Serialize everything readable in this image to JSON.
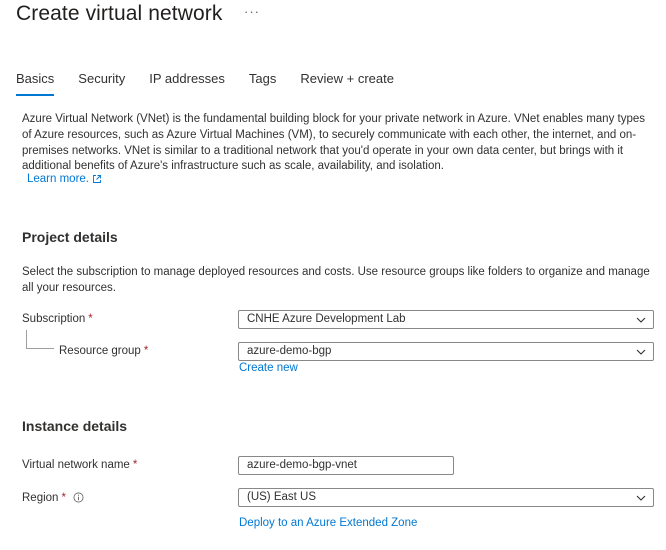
{
  "header": {
    "title": "Create virtual network",
    "more_label": "···"
  },
  "tabs": [
    {
      "label": "Basics",
      "active": true
    },
    {
      "label": "Security",
      "active": false
    },
    {
      "label": "IP addresses",
      "active": false
    },
    {
      "label": "Tags",
      "active": false
    },
    {
      "label": "Review + create",
      "active": false
    }
  ],
  "intro": {
    "text": "Azure Virtual Network (VNet) is the fundamental building block for your private network in Azure. VNet enables many types of Azure resources, such as Azure Virtual Machines (VM), to securely communicate with each other, the internet, and on-premises networks. VNet is similar to a traditional network that you'd operate in your own data center, but brings with it additional benefits of Azure's infrastructure such as scale, availability, and isolation.",
    "learn_more": "Learn more."
  },
  "project": {
    "heading": "Project details",
    "description": "Select the subscription to manage deployed resources and costs. Use resource groups like folders to organize and manage all your resources.",
    "subscription_label": "Subscription",
    "subscription_value": "CNHE Azure Development Lab",
    "resource_group_label": "Resource group",
    "resource_group_value": "azure-demo-bgp",
    "create_new": "Create new"
  },
  "instance": {
    "heading": "Instance details",
    "vnet_name_label": "Virtual network name",
    "vnet_name_value": "azure-demo-bgp-vnet",
    "region_label": "Region",
    "region_value": "(US) East US",
    "extended_zone_link": "Deploy to an Azure Extended Zone"
  },
  "required_marker": "*",
  "colors": {
    "accent": "#0078d4",
    "required": "#a4262c",
    "text": "#323130",
    "border": "#8a8886"
  }
}
